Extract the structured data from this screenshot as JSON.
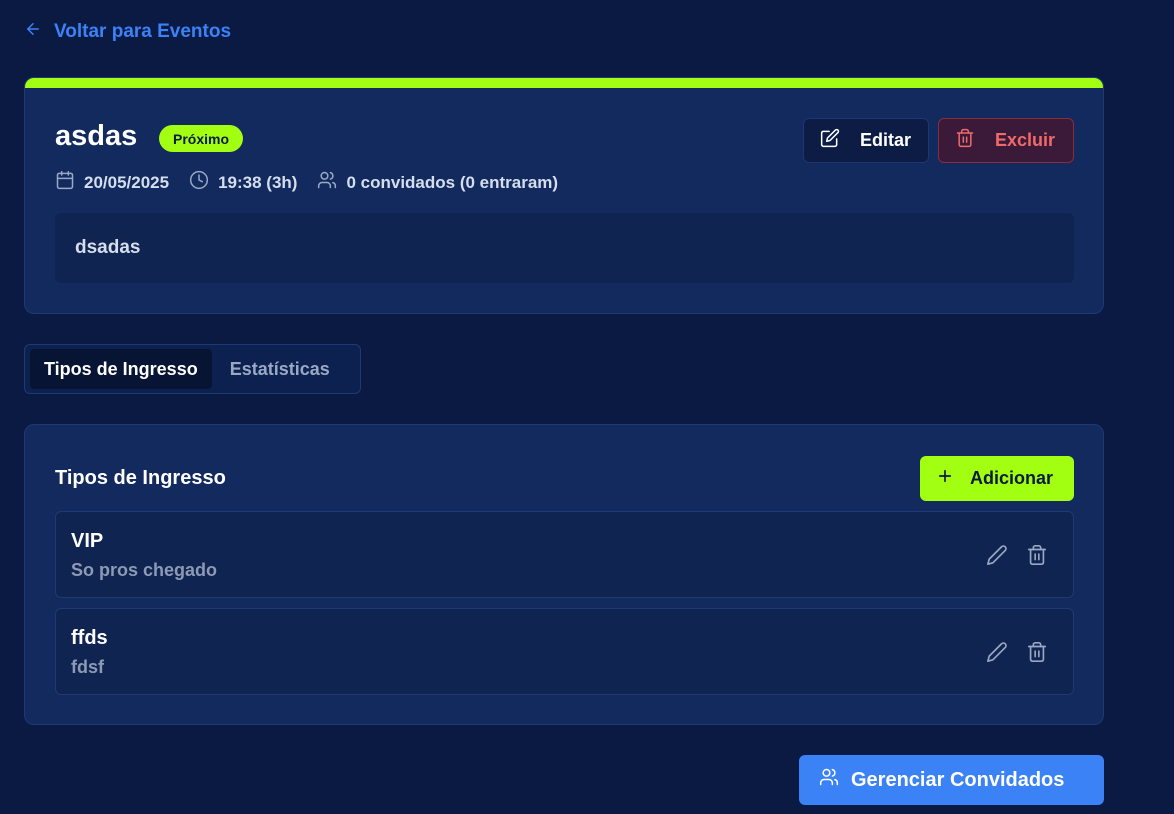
{
  "nav": {
    "back_label": "Voltar para Eventos"
  },
  "event": {
    "title": "asdas",
    "status": "Próximo",
    "date": "20/05/2025",
    "time": "19:38 (3h)",
    "guests": "0 convidados (0 entraram)",
    "description": "dsadas",
    "edit_label": "Editar",
    "delete_label": "Excluir"
  },
  "tabs": [
    {
      "label": "Tipos de Ingresso",
      "active": true
    },
    {
      "label": "Estatísticas",
      "active": false
    }
  ],
  "ticket_types": {
    "title": "Tipos de Ingresso",
    "add_label": "Adicionar",
    "items": [
      {
        "name": "VIP",
        "description": "So pros chegado"
      },
      {
        "name": "ffds",
        "description": "fdsf"
      }
    ]
  },
  "footer": {
    "manage_label": "Gerenciar Convidados"
  },
  "icons": {
    "back": "arrow-left-icon",
    "calendar": "calendar-icon",
    "clock": "clock-icon",
    "users": "users-icon",
    "edit": "edit-icon",
    "delete": "trash-icon",
    "add": "plus-icon",
    "pencil": "pencil-icon"
  },
  "colors": {
    "background": "#0a1a42",
    "card": "#122a5e",
    "accent_green": "#a3ff12",
    "primary_blue": "#3b82f6",
    "danger": "#f06a6a"
  }
}
